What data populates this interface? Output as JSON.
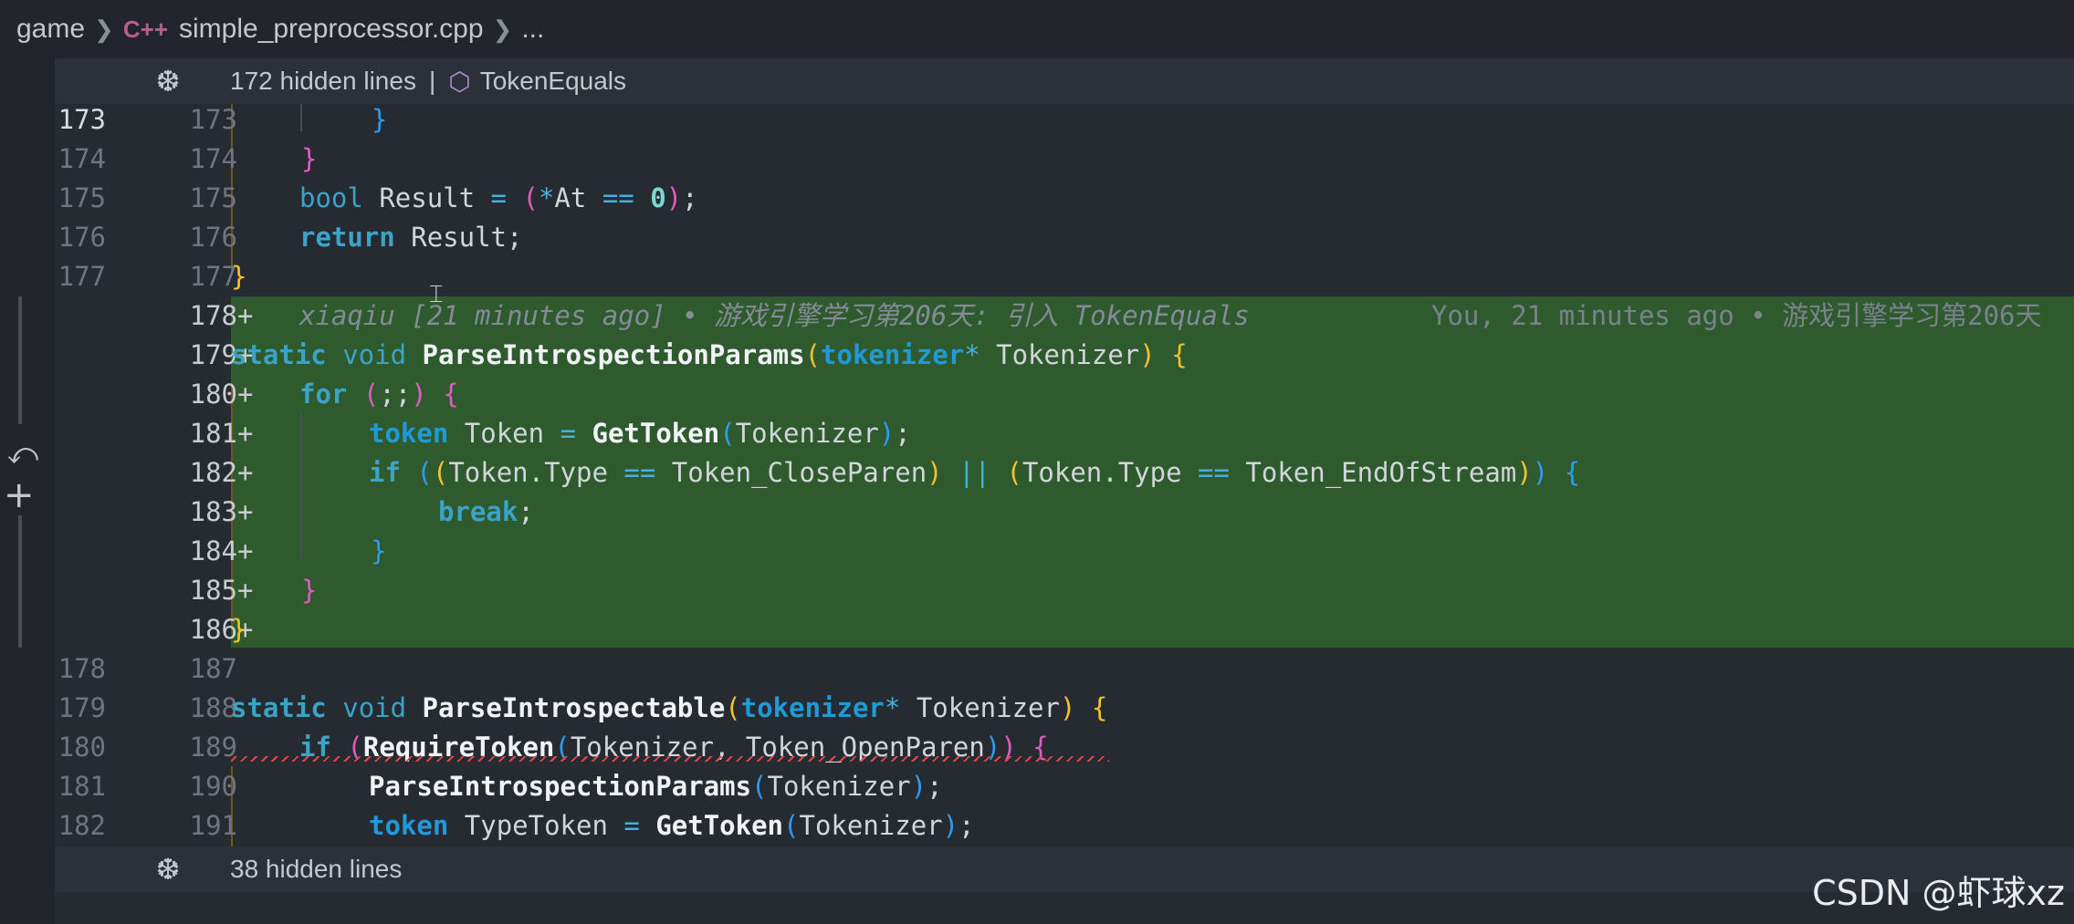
{
  "breadcrumb": {
    "folder": "game",
    "file_icon": "C++",
    "file": "simple_preprocessor.cpp",
    "more": "..."
  },
  "fold_top": {
    "hidden": "172 hidden lines",
    "pipe": "|",
    "symbol": "TokenEquals"
  },
  "fold_bottom": {
    "hidden": "38 hidden lines"
  },
  "blame": {
    "inline": "xiaqiu [21 minutes ago] • 游戏引擎学习第206天: 引入 TokenEquals",
    "right": "You, 21 minutes ago • 游戏引擎学习第206天"
  },
  "lines": [
    {
      "old": "173",
      "new": "173",
      "plus": ""
    },
    {
      "old": "174",
      "new": "174",
      "plus": ""
    },
    {
      "old": "175",
      "new": "175",
      "plus": ""
    },
    {
      "old": "176",
      "new": "176",
      "plus": ""
    },
    {
      "old": "177",
      "new": "177",
      "plus": ""
    },
    {
      "old": "",
      "new": "178",
      "plus": "+"
    },
    {
      "old": "",
      "new": "179",
      "plus": "+"
    },
    {
      "old": "",
      "new": "180",
      "plus": "+"
    },
    {
      "old": "",
      "new": "181",
      "plus": "+"
    },
    {
      "old": "",
      "new": "182",
      "plus": "+"
    },
    {
      "old": "",
      "new": "183",
      "plus": "+"
    },
    {
      "old": "",
      "new": "184",
      "plus": "+"
    },
    {
      "old": "",
      "new": "185",
      "plus": "+"
    },
    {
      "old": "",
      "new": "186",
      "plus": "+"
    },
    {
      "old": "178",
      "new": "187",
      "plus": ""
    },
    {
      "old": "179",
      "new": "188",
      "plus": ""
    },
    {
      "old": "180",
      "new": "189",
      "plus": ""
    },
    {
      "old": "181",
      "new": "190",
      "plus": ""
    },
    {
      "old": "182",
      "new": "191",
      "plus": ""
    }
  ],
  "tokens": {
    "brace_close": "}",
    "brace_open": "{",
    "bool": "bool",
    "result": "Result",
    "eq": "=",
    "lparen": "(",
    "rparen": ")",
    "star": "*",
    "at": "At",
    "eqeq": "==",
    "zero": "0",
    "semi": ";",
    "return": "return",
    "static": "static",
    "void": "void",
    "parse_params": "ParseIntrospectionParams",
    "tokenizer_t": "tokenizer",
    "tokenizer_v": "Tokenizer",
    "for": "for",
    "for_cond": ";;",
    "token_t": "token",
    "token_v": "Token",
    "get_token": "GetToken",
    "if": "if",
    "token_type": "Token.Type",
    "close_paren": "Token_CloseParen",
    "or": "||",
    "eos": "Token_EndOfStream",
    "break": "break",
    "parse_introspectable": "ParseIntrospectable",
    "require_token": "RequireToken",
    "comma": ",",
    "open_paren": "Token_OpenParen",
    "type_token": "TypeToken"
  },
  "watermark": "CSDN @虾球xz"
}
